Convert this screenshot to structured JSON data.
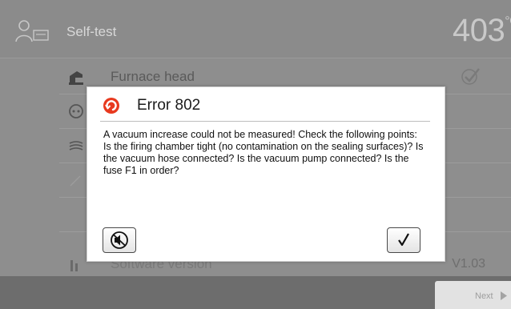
{
  "header": {
    "title": "Self-test",
    "temperature": "403",
    "temperature_unit": "°C"
  },
  "rows": [
    {
      "label": "Furnace head",
      "icon": "furnace-head-icon",
      "status": "check-icon"
    },
    {
      "label": "",
      "icon": "gear-icon"
    },
    {
      "label": "",
      "icon": "heating-icon"
    },
    {
      "label": "",
      "icon": ""
    },
    {
      "label": "",
      "icon": ""
    },
    {
      "label": "Software version",
      "value": "V1.03",
      "icon": "software-icon"
    }
  ],
  "footer": {
    "next_label": "Next"
  },
  "dialog": {
    "title": "Error 802",
    "message": "A vacuum increase could not be measured! Check the following points: Is the firing chamber tight (no contamination on the sealing surfaces)? Is the vacuum hose connected? Is the vacuum pump connected? Is the fuse F1 in order?",
    "error_color": "#e8391e",
    "mute_icon": "mute-speaker-icon",
    "ok_icon": "checkmark-icon"
  }
}
